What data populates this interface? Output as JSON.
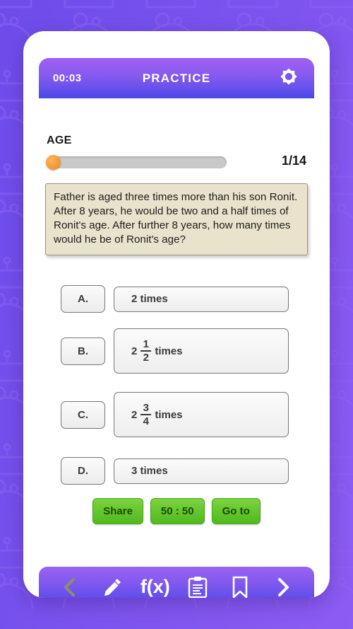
{
  "background": {
    "pattern_icon": "robot-head-outline",
    "color": "#7a52ee"
  },
  "header": {
    "timer": "00:03",
    "title": "PRACTICE",
    "settings_icon": "gear-icon"
  },
  "progress": {
    "topic_label": "AGE",
    "counter": "1/14",
    "current": 1,
    "total": 14,
    "thumb_color": "#f59a3a",
    "track_color": "#c9c9c9"
  },
  "question": {
    "text": "Father is aged three times more than his son Ronit. After 8 years, he would be two and a half times of Ronit's age. After further 8 years, how many times would he be of Ronit's age?"
  },
  "options": [
    {
      "letter": "A.",
      "text": "2 times",
      "whole": "",
      "num": "",
      "den": "",
      "suffix": ""
    },
    {
      "letter": "B.",
      "text": "",
      "whole": "2",
      "num": "1",
      "den": "2",
      "suffix": "times"
    },
    {
      "letter": "C.",
      "text": "",
      "whole": "2",
      "num": "3",
      "den": "4",
      "suffix": "times"
    },
    {
      "letter": "D.",
      "text": "3 times",
      "whole": "",
      "num": "",
      "den": "",
      "suffix": ""
    }
  ],
  "actions": [
    {
      "label": "Share",
      "name": "share-button"
    },
    {
      "label": "50 : 50",
      "name": "fifty-fifty-button"
    },
    {
      "label": "Go to",
      "name": "go-to-button"
    }
  ],
  "toolbar": {
    "items": [
      {
        "name": "previous-icon",
        "label": "previous"
      },
      {
        "name": "pencil-icon",
        "label": "edit"
      },
      {
        "name": "formula-icon",
        "label": "f(x)"
      },
      {
        "name": "clipboard-icon",
        "label": "notes"
      },
      {
        "name": "bookmark-icon",
        "label": "bookmark"
      },
      {
        "name": "next-icon",
        "label": "next"
      }
    ],
    "formula_label": "f(x)"
  }
}
